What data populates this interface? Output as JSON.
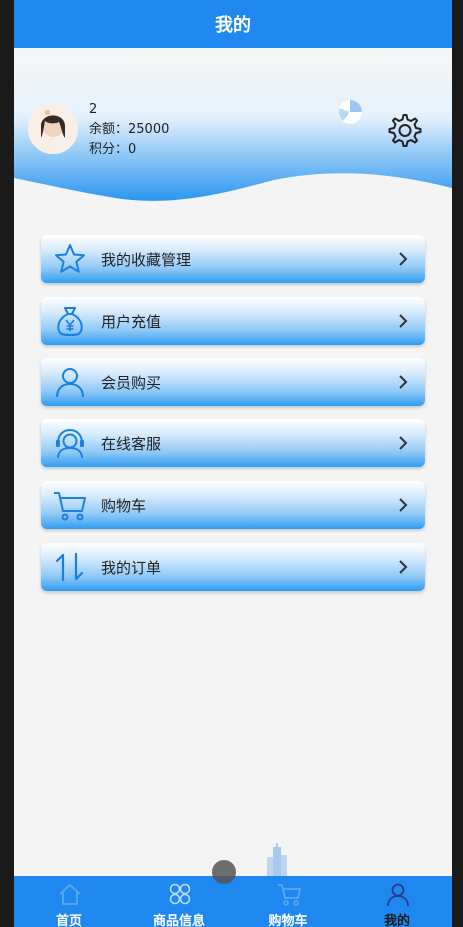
{
  "header": {
    "title": "我的"
  },
  "profile": {
    "username": "2",
    "balance_label": "余额：25000",
    "points_label": "积分：0"
  },
  "menu": [
    {
      "label": "我的收藏管理",
      "icon": "star-icon"
    },
    {
      "label": "用户充值",
      "icon": "money-bag-icon"
    },
    {
      "label": "会员购买",
      "icon": "user-icon"
    },
    {
      "label": "在线客服",
      "icon": "support-agent-icon"
    },
    {
      "label": "购物车",
      "icon": "cart-icon"
    },
    {
      "label": "我的订单",
      "icon": "sort-arrows-icon"
    }
  ],
  "tabbar": {
    "items": [
      {
        "label": "首页",
        "icon": "home-icon"
      },
      {
        "label": "商品信息",
        "icon": "grid-icon"
      },
      {
        "label": "购物车",
        "icon": "cart-icon"
      },
      {
        "label": "我的",
        "icon": "user-icon"
      }
    ],
    "active": "我的"
  },
  "colors": {
    "primary": "#1e88f0",
    "icon": "#1a7fe0",
    "text": "#222222"
  }
}
